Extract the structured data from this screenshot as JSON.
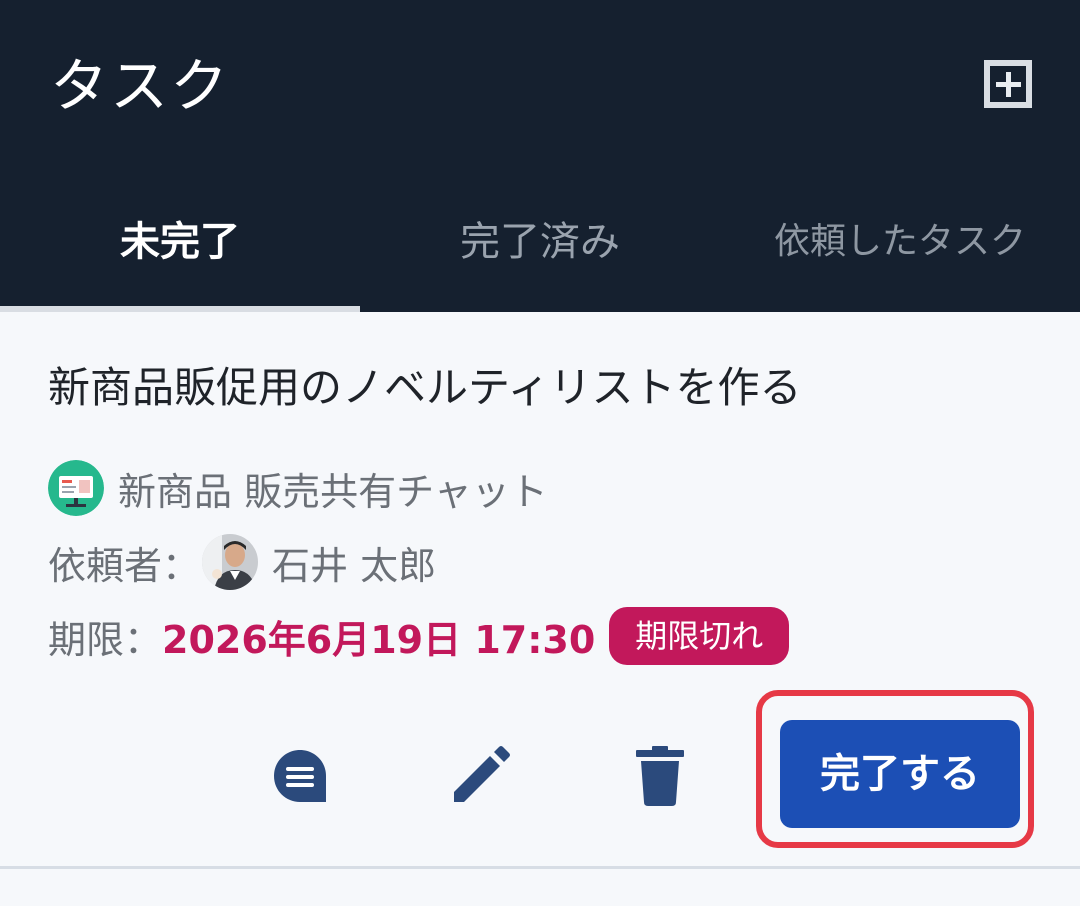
{
  "header": {
    "title": "タスク",
    "add_icon": "plus-square-icon"
  },
  "tabs": [
    {
      "label": "未完了",
      "active": true
    },
    {
      "label": "完了済み",
      "active": false
    },
    {
      "label": "依頼したタスク",
      "active": false
    }
  ],
  "task": {
    "title": "新商品販促用のノベルティリストを作る",
    "chat_name": "新商品 販売共有チャット",
    "requester_label": "依頼者：",
    "requester_name": "石井 太郎",
    "due_label": "期限：",
    "due_date": "2026年6月19日 17:30",
    "overdue_badge": "期限切れ",
    "complete_button": "完了する"
  },
  "colors": {
    "header_bg": "#15202f",
    "accent_blue": "#1c4fb5",
    "overdue": "#c2185b",
    "highlight": "#e63946",
    "icon_color": "#2b4a7c"
  }
}
